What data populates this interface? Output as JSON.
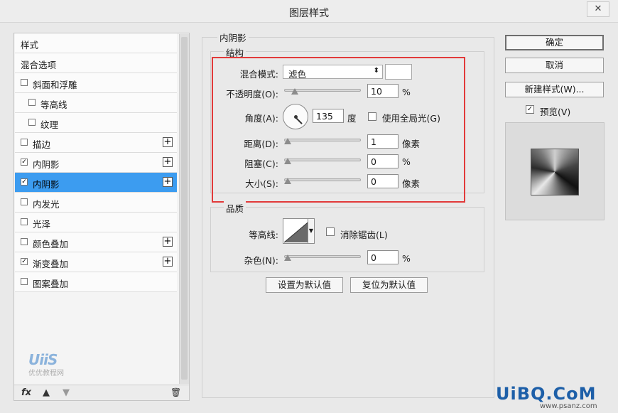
{
  "window": {
    "title": "图层样式",
    "close_glyph": "✕"
  },
  "styles_panel": {
    "items": [
      {
        "label": "样式",
        "checkbox": false,
        "checked": false,
        "indent": 0,
        "plus": false,
        "selected": false
      },
      {
        "label": "混合选项",
        "checkbox": false,
        "checked": false,
        "indent": 0,
        "plus": false,
        "selected": false
      },
      {
        "label": "斜面和浮雕",
        "checkbox": true,
        "checked": false,
        "indent": 0,
        "plus": false,
        "selected": false
      },
      {
        "label": "等高线",
        "checkbox": true,
        "checked": false,
        "indent": 1,
        "plus": false,
        "selected": false
      },
      {
        "label": "纹理",
        "checkbox": true,
        "checked": false,
        "indent": 1,
        "plus": false,
        "selected": false
      },
      {
        "label": "描边",
        "checkbox": true,
        "checked": false,
        "indent": 0,
        "plus": true,
        "selected": false
      },
      {
        "label": "内阴影",
        "checkbox": true,
        "checked": true,
        "indent": 0,
        "plus": true,
        "selected": false
      },
      {
        "label": "内阴影",
        "checkbox": true,
        "checked": true,
        "indent": 0,
        "plus": true,
        "selected": true
      },
      {
        "label": "内发光",
        "checkbox": true,
        "checked": false,
        "indent": 0,
        "plus": false,
        "selected": false
      },
      {
        "label": "光泽",
        "checkbox": true,
        "checked": false,
        "indent": 0,
        "plus": false,
        "selected": false
      },
      {
        "label": "颜色叠加",
        "checkbox": true,
        "checked": false,
        "indent": 0,
        "plus": true,
        "selected": false
      },
      {
        "label": "渐变叠加",
        "checkbox": true,
        "checked": true,
        "indent": 0,
        "plus": true,
        "selected": false
      },
      {
        "label": "图案叠加",
        "checkbox": true,
        "checked": false,
        "indent": 0,
        "plus": false,
        "selected": false
      }
    ],
    "footer": {
      "fx": "fx",
      "up": "▲",
      "down": "▼",
      "trash": "🗑"
    },
    "watermark_big": "UiiS",
    "watermark_small": "优优教程网"
  },
  "inner_shadow": {
    "section_title": "内阴影",
    "structure": {
      "title": "结构",
      "blend_mode_label": "混合模式:",
      "blend_mode_value": "滤色",
      "opacity_label": "不透明度(O):",
      "opacity_value": "10",
      "opacity_unit": "%",
      "angle_label": "角度(A):",
      "angle_value": "135",
      "angle_unit": "度",
      "global_light_label": "使用全局光(G)",
      "global_light_checked": false,
      "distance_label": "距离(D):",
      "distance_value": "1",
      "distance_unit": "像素",
      "choke_label": "阻塞(C):",
      "choke_value": "0",
      "choke_unit": "%",
      "size_label": "大小(S):",
      "size_value": "0",
      "size_unit": "像素",
      "slider_levels": {
        "opacity": 0.1,
        "distance": 0.0,
        "choke": 0.0,
        "size": 0.0
      }
    },
    "quality": {
      "title": "品质",
      "contour_label": "等高线:",
      "antialias_label": "消除锯齿(L)",
      "antialias_checked": false,
      "noise_label": "杂色(N):",
      "noise_value": "0",
      "noise_unit": "%",
      "noise_level": 0.0
    },
    "set_default_label": "设置为默认值",
    "reset_default_label": "复位为默认值"
  },
  "right_panel": {
    "ok_label": "确定",
    "cancel_label": "取消",
    "new_style_label": "新建样式(W)...",
    "preview_label": "预览(V)",
    "preview_checked": true
  },
  "watermark": {
    "text": "UiBQ.CoM",
    "sub": "www.psanz.com"
  },
  "colors": {
    "selected_row": "#3c9cf0",
    "highlight_box": "#e23a3a"
  }
}
